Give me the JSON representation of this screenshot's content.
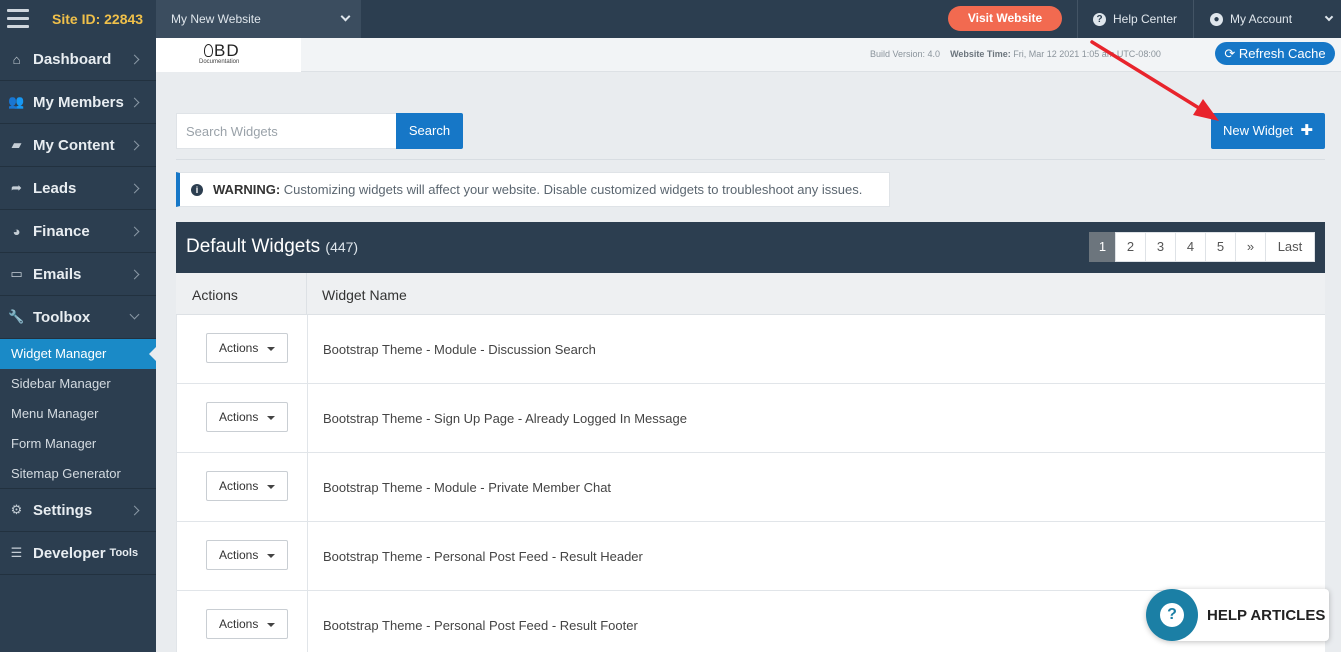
{
  "topbar": {
    "site_id": "Site ID: 22843",
    "site_select": "My New Website",
    "visit_label": "Visit Website",
    "help_center": "Help Center",
    "my_account": "My Account"
  },
  "sidebar": {
    "items": [
      {
        "label": "Dashboard",
        "icon": "home-icon"
      },
      {
        "label": "My Members",
        "icon": "users-icon"
      },
      {
        "label": "My Content",
        "icon": "folder-icon"
      },
      {
        "label": "Leads",
        "icon": "share-icon"
      },
      {
        "label": "Finance",
        "icon": "pie-chart-icon"
      },
      {
        "label": "Emails",
        "icon": "inbox-icon"
      },
      {
        "label": "Toolbox",
        "icon": "wrench-icon"
      }
    ],
    "toolbox_sub": [
      "Widget Manager",
      "Sidebar Manager",
      "Menu Manager",
      "Form Manager",
      "Sitemap Generator"
    ],
    "settings": "Settings",
    "developer": "Developer",
    "developer_small": "Tools"
  },
  "subheader": {
    "logo_text": "BD",
    "logo_sub": "Documentation",
    "build_version": "Build Version: 4.0",
    "website_time_label": "Website Time:",
    "website_time": "Fri, Mar 12 2021 1:05 am UTC-08:00",
    "refresh_label": "Refresh Cache"
  },
  "toolbar": {
    "search_placeholder": "Search Widgets",
    "search_label": "Search",
    "new_widget_label": "New Widget"
  },
  "warning": {
    "title": "WARNING:",
    "text": " Customizing widgets will affect your website. Disable customized widgets to troubleshoot any issues."
  },
  "panel": {
    "title": "Default Widgets",
    "count": "(447)",
    "pages": [
      "1",
      "2",
      "3",
      "4",
      "5",
      "»",
      "Last"
    ]
  },
  "table": {
    "headers": [
      "Actions",
      "Widget Name"
    ],
    "action_label": "Actions",
    "rows": [
      "Bootstrap Theme - Module - Discussion Search",
      "Bootstrap Theme - Sign Up Page - Already Logged In Message",
      "Bootstrap Theme - Module - Private Member Chat",
      "Bootstrap Theme - Personal Post Feed - Result Header",
      "Bootstrap Theme - Personal Post Feed - Result Footer"
    ]
  },
  "help": {
    "label": "HELP ARTICLES"
  },
  "colors": {
    "navy": "#2c3e50",
    "primary": "#1677c7",
    "visit": "#f26a50",
    "site_id": "#f0c04a",
    "annotation_arrow": "#e8242c"
  }
}
